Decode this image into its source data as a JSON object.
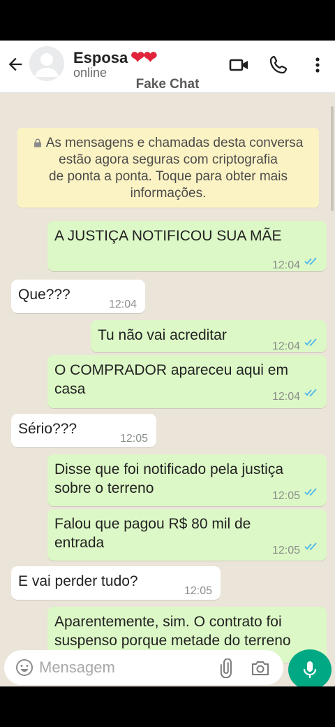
{
  "header": {
    "contact_name": "Esposa",
    "hearts": "❤❤",
    "status": "online",
    "watermark": "Fake Chat"
  },
  "encryption_notice": {
    "lines": [
      "As mensagens e chamadas desta conversa",
      "estão agora seguras com criptografia",
      "de ponta a ponta. Toque para obter mais",
      "informações."
    ]
  },
  "messages": [
    {
      "dir": "out",
      "text": "A JUSTIÇA NOTIFICOU SUA MÃE",
      "time": "12:04",
      "read": true
    },
    {
      "dir": "in",
      "text": "Que???",
      "time": "12:04"
    },
    {
      "dir": "out",
      "text": "Tu não vai acreditar",
      "time": "12:04",
      "read": true
    },
    {
      "dir": "out",
      "text": "O COMPRADOR apareceu aqui em casa",
      "time": "12:04",
      "read": true
    },
    {
      "dir": "in",
      "text": "Sério???",
      "time": "12:05"
    },
    {
      "dir": "out",
      "text": "Disse que foi notificado pela justiça sobre o terreno",
      "time": "12:05",
      "read": true
    },
    {
      "dir": "out",
      "text": "Falou que pagou R$ 80 mil de entrada",
      "time": "12:05",
      "read": true
    },
    {
      "dir": "in",
      "text": "E vai perder tudo?",
      "time": "12:05"
    },
    {
      "dir": "out",
      "text": "Aparentemente, sim. O contrato foi suspenso porque metade do terreno",
      "time": "",
      "read": false
    }
  ],
  "input": {
    "placeholder": "Mensagem"
  },
  "colors": {
    "outgoing_bubble": "#dcf8c6",
    "incoming_bubble": "#ffffff",
    "chat_background": "#ebe4d8",
    "notice_background": "#fcf3c4",
    "read_ticks": "#4fb6ec",
    "mic_button": "#00a884"
  },
  "icons": [
    "back-arrow-icon",
    "video-call-icon",
    "voice-call-icon",
    "more-options-icon",
    "lock-icon",
    "emoji-icon",
    "attach-icon",
    "camera-icon",
    "mic-icon",
    "scroll-down-icon"
  ]
}
